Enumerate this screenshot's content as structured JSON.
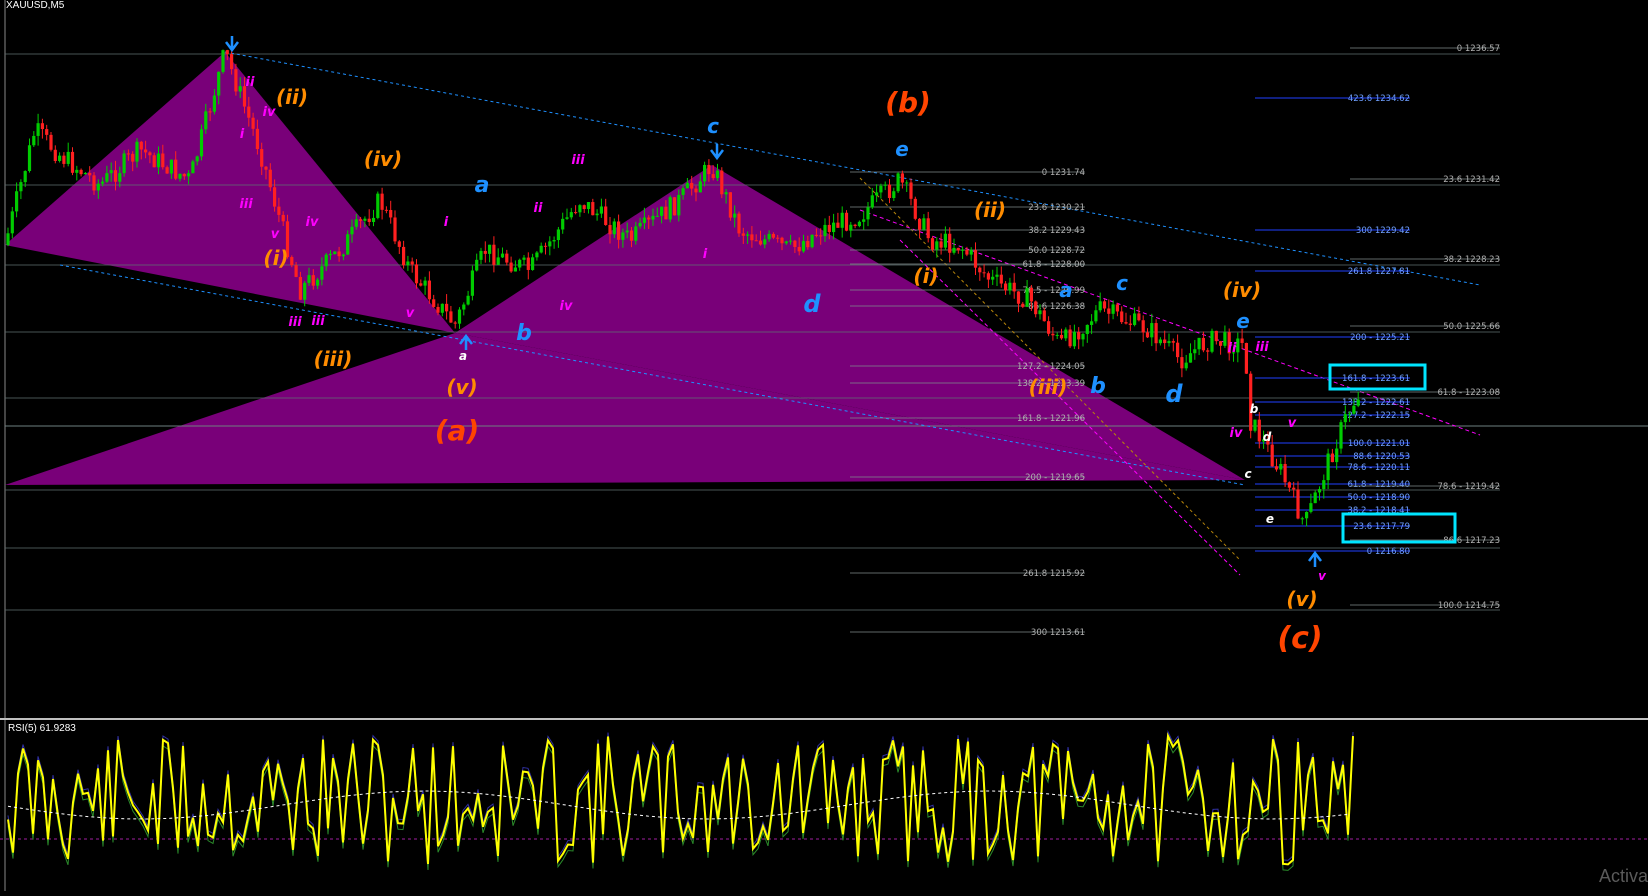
{
  "window": {
    "symbol_title": "XAUUSD,M5",
    "rsi_title": "RSI(5) 61.9283",
    "watermark": "Activa"
  },
  "colors": {
    "pattern_fill": "#800080",
    "fib_blue": "#2040ff",
    "fib_grey": "#7f8c8d",
    "wave_orange": "#ff8c00",
    "wave_red": "#ff4500",
    "wave_cyan": "#1e90ff",
    "wave_magenta": "#ff00ff",
    "highlight_box": "#00e5ff",
    "rsi_line": "#ffff00",
    "candle_up": "#00cc00",
    "candle_down": "#ff2020",
    "bg": "#000000"
  },
  "fib_labels_left": [
    {
      "text": "0 1231.74"
    },
    {
      "text": "23.6 1230.21"
    },
    {
      "text": "38.2 1229.43"
    },
    {
      "text": "50.0 1228.72"
    },
    {
      "text": "61.8 - 1228.00"
    },
    {
      "text": "76.5 - 1226.99"
    },
    {
      "text": "86.6 1226.38"
    },
    {
      "text": "127.2 - 1224.05"
    },
    {
      "text": "138.2 - 1223.39"
    },
    {
      "text": "161.8 - 1221.96"
    },
    {
      "text": "200 - 1219.65"
    },
    {
      "text": "261.8 1215.92"
    },
    {
      "text": "300 1213.61"
    }
  ],
  "fib_labels_mid": [
    {
      "text": "423.6 1234.62"
    },
    {
      "text": "300 1229.42"
    },
    {
      "text": "261.8 1227.81"
    },
    {
      "text": "200 - 1225.21"
    },
    {
      "text": "161.8 - 1223.61"
    },
    {
      "text": "138.2 - 1222.61"
    },
    {
      "text": "127.2 - 1222.15"
    },
    {
      "text": "100.0 1221.01"
    },
    {
      "text": "88.6 1220.53"
    },
    {
      "text": "78.6 - 1220.11"
    },
    {
      "text": "61.8 - 1219.40"
    },
    {
      "text": "50.0 - 1218.90"
    },
    {
      "text": "38.2 - 1218.41"
    },
    {
      "text": "23.6 1217.79"
    },
    {
      "text": "0 1216.80"
    }
  ],
  "fib_labels_right": [
    {
      "text": "0 1236.57"
    },
    {
      "text": "23.6 1231.42"
    },
    {
      "text": "38.2 1228.23"
    },
    {
      "text": "50.0 1225.66"
    },
    {
      "text": "61.8 - 1223.08"
    },
    {
      "text": "78.6 - 1219.42"
    },
    {
      "text": "86.6 1217.23"
    },
    {
      "text": "100.0 1214.75"
    }
  ],
  "wave_labels": [
    {
      "text": "(ii)",
      "color": "orange"
    },
    {
      "text": "(iv)",
      "color": "orange"
    },
    {
      "text": "(i)",
      "color": "orange"
    },
    {
      "text": "(iii)",
      "color": "orange"
    },
    {
      "text": "(v)",
      "color": "orange"
    },
    {
      "text": "(a)",
      "color": "red"
    },
    {
      "text": "a",
      "color": "cyan"
    },
    {
      "text": "b",
      "color": "cyan"
    },
    {
      "text": "c",
      "color": "cyan"
    },
    {
      "text": "d",
      "color": "cyan"
    },
    {
      "text": "(b)",
      "color": "red"
    },
    {
      "text": "e",
      "color": "cyan"
    },
    {
      "text": "(ii)",
      "color": "orange"
    },
    {
      "text": "(i)",
      "color": "orange"
    },
    {
      "text": "a",
      "color": "cyan"
    },
    {
      "text": "c",
      "color": "cyan"
    },
    {
      "text": "(iii)",
      "color": "orange"
    },
    {
      "text": "b",
      "color": "cyan"
    },
    {
      "text": "d",
      "color": "cyan"
    },
    {
      "text": "(iv)",
      "color": "orange"
    },
    {
      "text": "e",
      "color": "cyan"
    },
    {
      "text": "(v)",
      "color": "orange"
    },
    {
      "text": "(c)",
      "color": "red"
    },
    {
      "text": "ii",
      "color": "magenta"
    },
    {
      "text": "iv",
      "color": "magenta"
    },
    {
      "text": "i",
      "color": "magenta"
    },
    {
      "text": "iii",
      "color": "magenta"
    },
    {
      "text": "v",
      "color": "magenta"
    },
    {
      "text": "iii",
      "color": "magenta"
    },
    {
      "text": "iv",
      "color": "magenta"
    },
    {
      "text": "i",
      "color": "magenta"
    },
    {
      "text": "ii",
      "color": "magenta"
    },
    {
      "text": "iii",
      "color": "magenta"
    },
    {
      "text": "iv",
      "color": "magenta"
    },
    {
      "text": "v",
      "color": "magenta"
    },
    {
      "text": "iii",
      "color": "magenta"
    },
    {
      "text": "i",
      "color": "magenta"
    },
    {
      "text": "ii",
      "color": "magenta"
    },
    {
      "text": "iii",
      "color": "magenta"
    },
    {
      "text": "iv",
      "color": "magenta"
    },
    {
      "text": "v",
      "color": "magenta"
    },
    {
      "text": "v",
      "color": "magenta"
    },
    {
      "text": "a",
      "color": "white"
    },
    {
      "text": "b",
      "color": "white"
    },
    {
      "text": "c",
      "color": "white"
    },
    {
      "text": "d",
      "color": "white"
    },
    {
      "text": "e",
      "color": "white"
    }
  ]
}
